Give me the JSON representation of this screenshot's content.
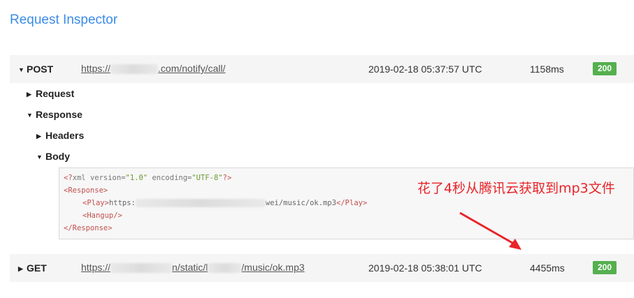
{
  "page_title": "Request Inspector",
  "requests": [
    {
      "method": "POST",
      "url_prefix": "https://",
      "url_suffix": ".com/notify/call/",
      "timestamp": "2019-02-18 05:37:57 UTC",
      "duration": "1158ms",
      "status": "200"
    },
    {
      "method": "GET",
      "url_prefix": "https://",
      "url_mid": "n/static/l",
      "url_suffix": "/music/ok.mp3",
      "timestamp": "2019-02-18 05:38:01 UTC",
      "duration": "4455ms",
      "status": "200"
    }
  ],
  "tree": {
    "request_label": "Request",
    "response_label": "Response",
    "headers_label": "Headers",
    "body_label": "Body"
  },
  "body_code": {
    "decl_open": "<?",
    "decl_name": "xml",
    "decl_attr1_name": " version=",
    "decl_attr1_val": "\"1.0\"",
    "decl_attr2_name": " encoding=",
    "decl_attr2_val": "\"UTF-8\"",
    "decl_close": "?>",
    "response_open": "<Response>",
    "play_open": "<Play>",
    "play_prefix": "https:",
    "play_suffix": "wei/music/ok.mp3",
    "play_close": "</Play>",
    "hangup": "<Hangup/>",
    "response_close": "</Response>"
  },
  "annotation": "花了4秒从腾讯云获取到mp3文件",
  "colors": {
    "title": "#3c8ce7",
    "badge": "#55b04f",
    "annotation": "#e8252a"
  }
}
